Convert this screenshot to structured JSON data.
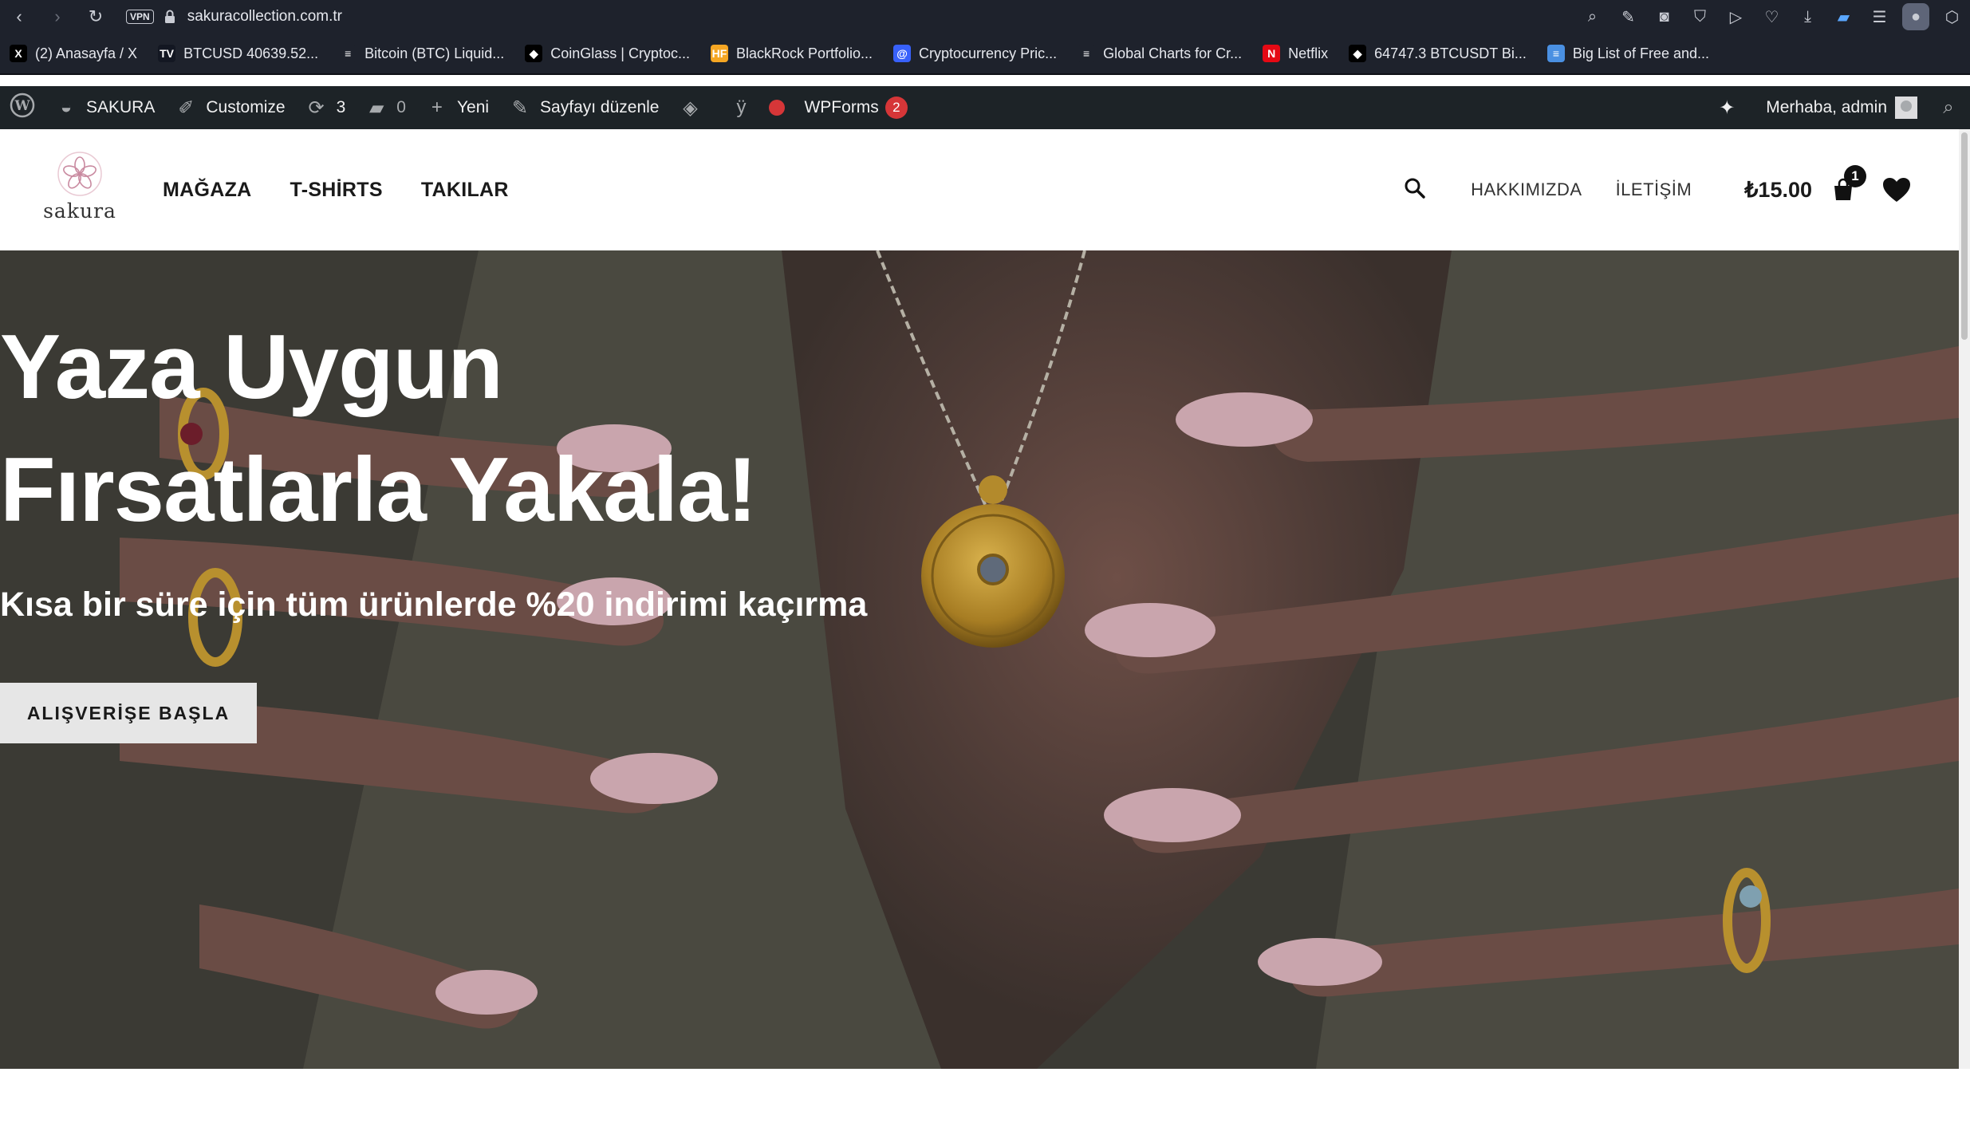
{
  "browser": {
    "vpn_label": "VPN",
    "url": "sakuracollection.com.tr",
    "bookmarks": [
      {
        "label": "(2) Anasayfa / X",
        "icon": "x-icon",
        "icon_text": "X",
        "color": "#000000"
      },
      {
        "label": "BTCUSD 40639.52...",
        "icon": "tradingview-icon",
        "icon_text": "TV",
        "color": "#131722"
      },
      {
        "label": "Bitcoin (BTC) Liquid...",
        "icon": "list-icon",
        "icon_text": "≡",
        "color": "#1e222c"
      },
      {
        "label": "CoinGlass | Cryptoc...",
        "icon": "coinglass-icon",
        "icon_text": "◆",
        "color": "#000000"
      },
      {
        "label": "BlackRock Portfolio...",
        "icon": "hf-icon",
        "icon_text": "HF",
        "color": "#f5a623"
      },
      {
        "label": "Cryptocurrency Pric...",
        "icon": "coin-icon",
        "icon_text": "@",
        "color": "#3861fb"
      },
      {
        "label": "Global Charts for Cr...",
        "icon": "list-icon",
        "icon_text": "≡",
        "color": "#1e222c"
      },
      {
        "label": "Netflix",
        "icon": "netflix-icon",
        "icon_text": "N",
        "color": "#e50914"
      },
      {
        "label": "64747.3 BTCUSDT Bi...",
        "icon": "coinglass-icon",
        "icon_text": "◆",
        "color": "#000000"
      },
      {
        "label": "Big List of Free and...",
        "icon": "bars-icon",
        "icon_text": "≡",
        "color": "#4a90e2"
      }
    ]
  },
  "adminbar": {
    "site_name": "SAKURA",
    "customize": "Customize",
    "updates_count": "3",
    "comments_count": "0",
    "new_label": "Yeni",
    "edit_page": "Sayfayı düzenle",
    "wpforms": "WPForms",
    "wpforms_count": "2",
    "greeting": "Merhaba, admin"
  },
  "header": {
    "logo_text": "sakura",
    "nav": [
      "MAĞAZA",
      "T-SHİRTS",
      "TAKILAR"
    ],
    "about": "HAKKIMIZDA",
    "contact": "İLETİŞİM",
    "cart_total": "₺15.00",
    "cart_count": "1"
  },
  "hero": {
    "title": "Yaza Uygun Fırsatlarla Yakala!",
    "subtitle": "Kısa bir süre için tüm ürünlerde %20 indirimi kaçırma",
    "button": "ALIŞVERİŞE BAŞLA"
  },
  "colors": {
    "admin_bar": "#1d2327",
    "browser_chrome": "#1e222c",
    "badge": "#d63638",
    "hero_overlay": "#2e2b28"
  }
}
